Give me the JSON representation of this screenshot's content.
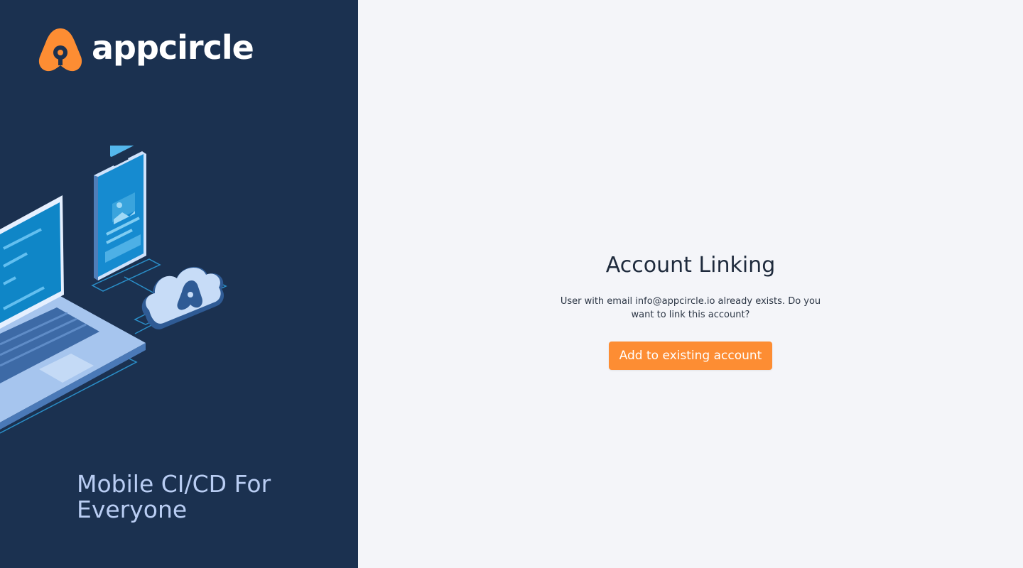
{
  "brand": {
    "name": "appcircle",
    "tagline": "Mobile CI/CD For Everyone",
    "logo_icon": "appcircle-logo-icon",
    "accent_color": "#fd8d33",
    "sidebar_color": "#1b3150"
  },
  "account_linking": {
    "title": "Account Linking",
    "message": "User with email info@appcircle.io already exists. Do you want to link this account?",
    "button_label": "Add to existing account"
  }
}
